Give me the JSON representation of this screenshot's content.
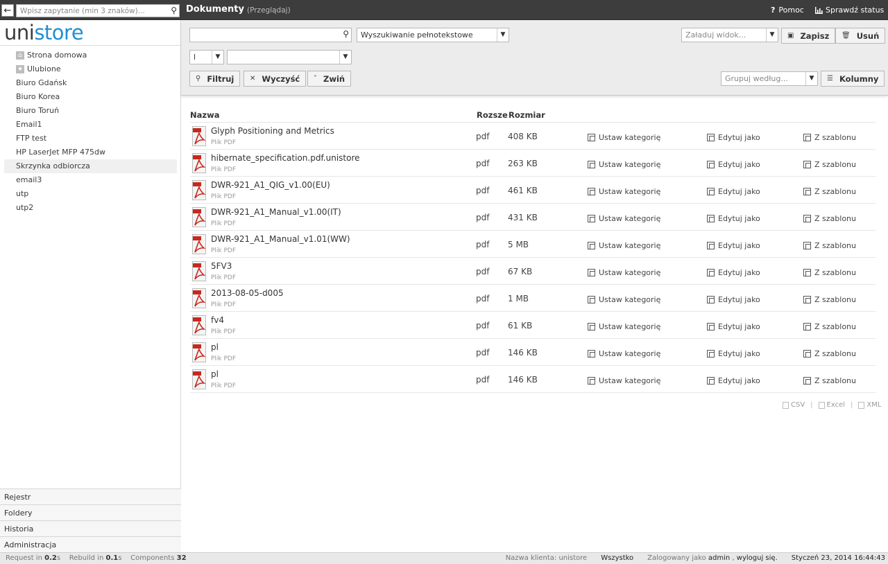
{
  "search": {
    "placeholder": "Wpisz zapytanie (min 3 znaków)..."
  },
  "logo": {
    "part1": "uni",
    "part2": "store"
  },
  "sidebar": {
    "items": [
      {
        "label": "Strona domowa",
        "icon": "home-icon"
      },
      {
        "label": "Ulubione",
        "icon": "star-icon"
      },
      {
        "label": "Biuro Gdańsk"
      },
      {
        "label": "Biuro Korea"
      },
      {
        "label": "Biuro Toruń"
      },
      {
        "label": "Email1"
      },
      {
        "label": "FTP test"
      },
      {
        "label": "HP LaserJet MFP 475dw"
      },
      {
        "label": "Skrzynka odbiorcza"
      },
      {
        "label": "email3"
      },
      {
        "label": "utp"
      },
      {
        "label": "utp2"
      }
    ],
    "bottom": [
      "Rejestr",
      "Foldery",
      "Historia",
      "Administracja"
    ]
  },
  "header": {
    "title": "Dokumenty",
    "subtitle": "(Przeglądaj)",
    "help": "Pomoc",
    "status": "Sprawdź status"
  },
  "toolbar": {
    "search_mode": "Wyszukiwanie pełnotekstowe",
    "small_select": "l",
    "load_view": "Załaduj widok...",
    "save": "Zapisz",
    "delete": "Usuń",
    "filter": "Filtruj",
    "clear": "Wyczyść",
    "collapse": "Zwiń",
    "group_by": "Grupuj według...",
    "columns": "Kolumny"
  },
  "table": {
    "headers": {
      "name": "Nazwa",
      "ext": "Rozsze",
      "size": "Rozmiar"
    },
    "actions": {
      "category": "Ustaw kategorię",
      "edit": "Edytuj jako",
      "template": "Z szablonu"
    },
    "rows": [
      {
        "name": "Glyph Positioning and Metrics",
        "type": "Plik PDF",
        "ext": "pdf",
        "size": "408 KB"
      },
      {
        "name": "hibernate_specification.pdf.unistore",
        "type": "Plik PDF",
        "ext": "pdf",
        "size": "263 KB"
      },
      {
        "name": "DWR-921_A1_QIG_v1.00(EU)",
        "type": "Plik PDF",
        "ext": "pdf",
        "size": "461 KB"
      },
      {
        "name": "DWR-921_A1_Manual_v1.00(IT)",
        "type": "Plik PDF",
        "ext": "pdf",
        "size": "431 KB"
      },
      {
        "name": "DWR-921_A1_Manual_v1.01(WW)",
        "type": "Plik PDF",
        "ext": "pdf",
        "size": "5 MB"
      },
      {
        "name": "5FV3",
        "type": "Plik PDF",
        "ext": "pdf",
        "size": "67 KB"
      },
      {
        "name": "2013-08-05-d005",
        "type": "Plik PDF",
        "ext": "pdf",
        "size": "1 MB"
      },
      {
        "name": "fv4",
        "type": "Plik PDF",
        "ext": "pdf",
        "size": "61 KB"
      },
      {
        "name": "pl",
        "type": "Plik PDF",
        "ext": "pdf",
        "size": "146 KB"
      },
      {
        "name": "pl",
        "type": "Plik PDF",
        "ext": "pdf",
        "size": "146 KB"
      }
    ]
  },
  "export": {
    "csv": "CSV",
    "excel": "Excel",
    "xml": "XML"
  },
  "footer": {
    "request_label": "Request in",
    "request_val": "0.2",
    "rebuild_label": "Rebuild in",
    "rebuild_val": "0.1",
    "components_label": "Components",
    "components_val": "32",
    "client_label": "Nazwa klienta: unistore",
    "scope": "Wszystko",
    "logged_label": "Zalogowany jako",
    "user": "admin",
    "logout": "wyloguj się.",
    "datetime": "Styczeń 23, 2014 16:44:43"
  },
  "colors": {
    "topbar": "#3d3d3d",
    "brand": "#1f8fd6",
    "pdf_red": "#c8281e"
  }
}
